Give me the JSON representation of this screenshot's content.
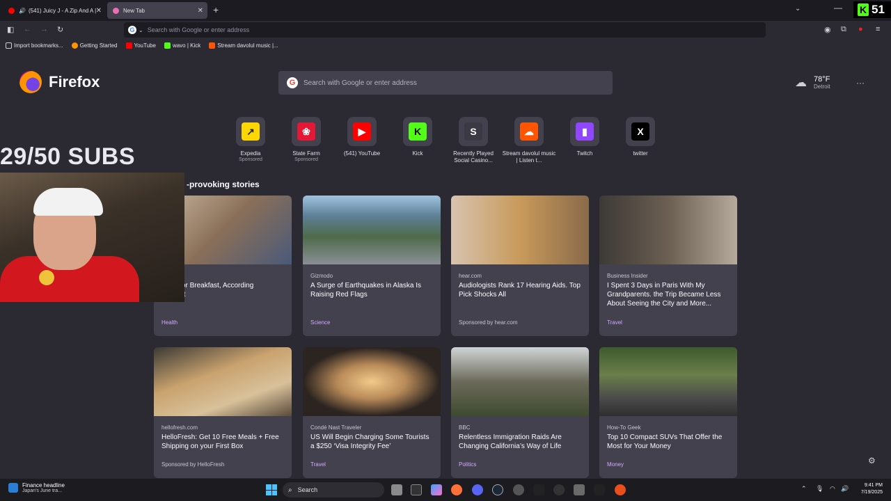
{
  "tabs": [
    {
      "label": "(541) Juicy J - A Zip And A |",
      "active": false,
      "audio": true
    },
    {
      "label": "New Tab",
      "active": true
    }
  ],
  "kick_badge": {
    "count": "51"
  },
  "urlbar": {
    "placeholder": "Search with Google or enter address"
  },
  "bookmarks": [
    {
      "label": "Import bookmarks...",
      "icon": "import-icon",
      "color": "#cfcfd8"
    },
    {
      "label": "Getting Started",
      "icon": "firefox-icon",
      "color": "#ff9400"
    },
    {
      "label": "YouTube",
      "icon": "youtube-icon",
      "color": "#ff0000"
    },
    {
      "label": "wavo | Kick",
      "icon": "kick-icon",
      "color": "#53fc18"
    },
    {
      "label": "Stream davolul music |...",
      "icon": "soundcloud-icon",
      "color": "#ff5500"
    }
  ],
  "brand": {
    "name": "Firefox"
  },
  "search": {
    "placeholder": "Search with Google or enter address"
  },
  "weather": {
    "temp": "78°F",
    "city": "Detroit"
  },
  "shortcuts": [
    {
      "label": "Expedia",
      "sub": "Sponsored",
      "icon": "expedia-icon",
      "bg": "#ffd700",
      "fg": "#1e243a",
      "glyph": "↗"
    },
    {
      "label": "State Farm",
      "sub": "Sponsored",
      "icon": "statefarm-icon",
      "bg": "#e31837",
      "fg": "#ffffff",
      "glyph": "❀"
    },
    {
      "label": "(541) YouTube",
      "sub": "",
      "icon": "youtube-icon",
      "bg": "#ff0000",
      "fg": "#ffffff",
      "glyph": "▶"
    },
    {
      "label": "Kick",
      "sub": "",
      "icon": "kick-icon",
      "bg": "#53fc18",
      "fg": "#000000",
      "glyph": "K"
    },
    {
      "label": "Recently Played Social Casino...",
      "sub": "",
      "icon": "stake-icon",
      "bg": "#3a3944",
      "fg": "#ffffff",
      "glyph": "S"
    },
    {
      "label": "Stream davolul music | Listen t...",
      "sub": "",
      "icon": "soundcloud-icon",
      "bg": "#ff5500",
      "fg": "#ffffff",
      "glyph": "☁"
    },
    {
      "label": "Twitch",
      "sub": "",
      "icon": "twitch-icon",
      "bg": "#9146ff",
      "fg": "#ffffff",
      "glyph": "▮"
    },
    {
      "label": "twitter",
      "sub": "",
      "icon": "x-icon",
      "bg": "#000000",
      "fg": "#ffffff",
      "glyph": "X"
    }
  ],
  "overlay": {
    "subs": "29/50 SUBS"
  },
  "section": {
    "title": "-provoking stories"
  },
  "stories": [
    {
      "source": "",
      "title": "o Eat for Breakfast, According\ntritionist",
      "category": "Health",
      "sponsored": false,
      "img": "linear-gradient(135deg,#c9b7a0,#8a6f58 50%,#4a5a7a)"
    },
    {
      "source": "Gizmodo",
      "title": "A Surge of Earthquakes in Alaska Is Raising Red Flags",
      "category": "Science",
      "sponsored": false,
      "img": "linear-gradient(180deg,#9fc3e0 0%,#5d7f95 30%,#4f6b4a 60%,#8a8f96 100%)"
    },
    {
      "source": "hear.com",
      "title": "Audiologists Rank 17 Hearing Aids. Top Pick Shocks All",
      "category": "Sponsored by hear.com",
      "sponsored": true,
      "img": "linear-gradient(90deg,#d7c3b0,#c89a5a 50%,#8a6a4a)"
    },
    {
      "source": "Business Insider",
      "title": "I Spent 3 Days in Paris With My Grandparents. the Trip Became Less About Seeing the City and More...",
      "category": "Travel",
      "sponsored": false,
      "img": "linear-gradient(90deg,#3d3a36,#6b5f52 50%,#b5aa9c)"
    },
    {
      "source": "hellofresh.com",
      "title": "HelloFresh: Get 10 Free Meals + Free Shipping on your First Box",
      "category": "Sponsored by HelloFresh",
      "sponsored": true,
      "img": "linear-gradient(160deg,#3b3a35,#c9a26e 40%,#d8c19a 70%,#5a4a3a)"
    },
    {
      "source": "Condé Nast Traveler",
      "title": "US Will Begin Charging Some Tourists a $250 ‘Visa Integrity Fee’",
      "category": "Travel",
      "sponsored": false,
      "img": "radial-gradient(ellipse at 50% 50%,#f2c98a 0%,#b88a58 35%,#2b2420 70%)"
    },
    {
      "source": "BBC",
      "title": "Relentless Immigration Raids Are Changing California’s Way of Life",
      "category": "Politics",
      "sponsored": false,
      "img": "linear-gradient(180deg,#cfd4d6 0%,#6b6a5a 50%,#3f4a30 100%)"
    },
    {
      "source": "How-To Geek",
      "title": "Top 10 Compact SUVs That Offer the Most for Your Money",
      "category": "Money",
      "sponsored": false,
      "img": "linear-gradient(180deg,#3f5a2e 0%,#6a7f4a 40%,#4a4a4a 75%,#2e2e2e 100%)"
    }
  ],
  "taskbar": {
    "news_title": "Finance headline",
    "news_sub": "Japan's June tra...",
    "search_label": "Search",
    "time": "9:41 PM",
    "date": "7/19/2025"
  }
}
